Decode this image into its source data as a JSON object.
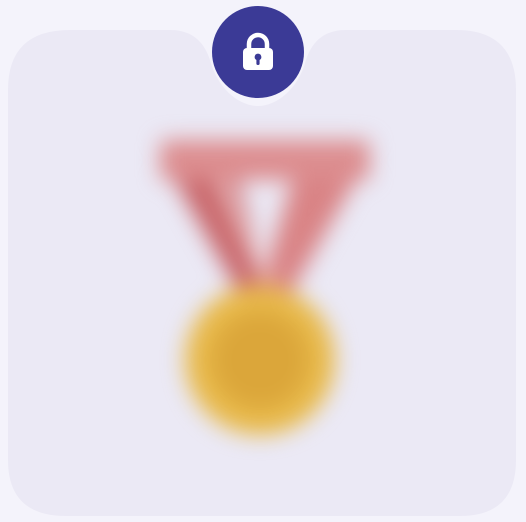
{
  "badge_card": {
    "state": "locked",
    "colors": {
      "page_background": "#f4f3fb",
      "card_background": "#ebe9f5",
      "accent": "#3b3a96",
      "medal_gold": "#e8b94a",
      "ribbon_red": "#d77b7d"
    },
    "lock_icon": "lock-icon",
    "medal_icon": "medal-icon",
    "medal_blurred": true
  }
}
